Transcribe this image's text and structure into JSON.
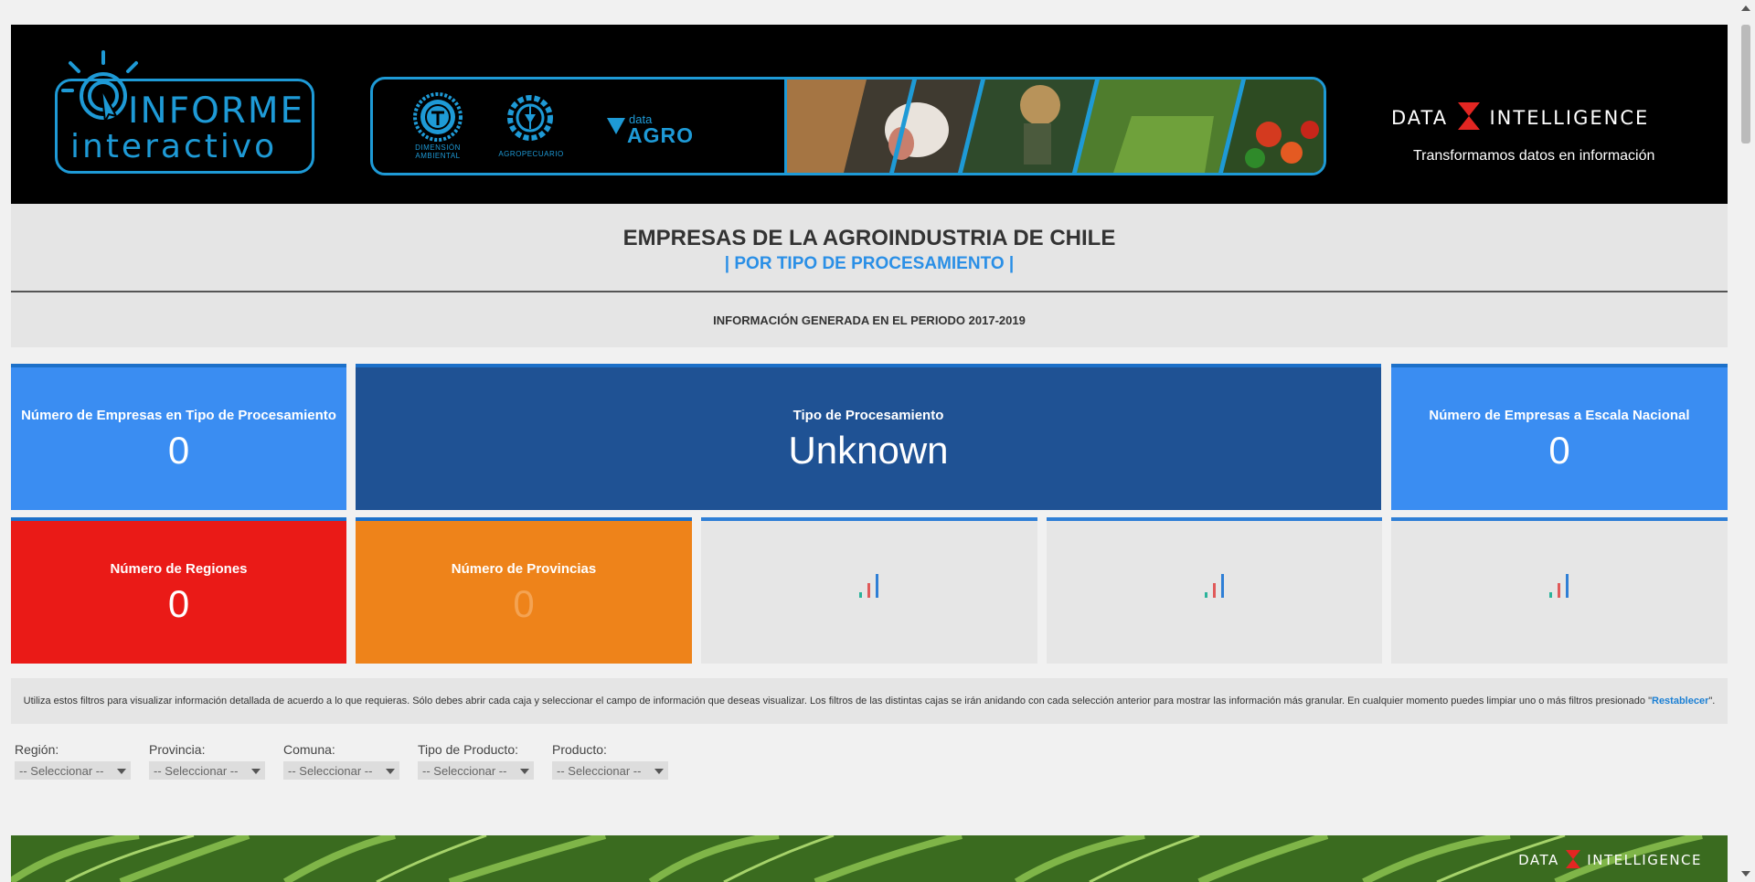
{
  "header": {
    "logo_line1": "INFORME",
    "logo_line2": "interactivo",
    "badges": {
      "dimension": "DIMENSIÓN AMBIENTAL",
      "agro": "AGROPECUARIO",
      "data_small": "data",
      "data_big": "AGRO"
    },
    "brand_left": "DATA",
    "brand_right": "INTELLIGENCE",
    "tagline": "Transformamos datos en información"
  },
  "title": {
    "main": "EMPRESAS DE LA AGROINDUSTRIA DE CHILE",
    "sub": "| POR TIPO DE PROCESAMIENTO |",
    "period": "INFORMACIÓN GENERADA EN EL PERIODO 2017-2019"
  },
  "cards": {
    "empresas_tipo": {
      "label": "Número de Empresas en Tipo de Procesamiento",
      "value": "0"
    },
    "tipo": {
      "label": "Tipo de Procesamiento",
      "value": "Unknown"
    },
    "empresas_nacional": {
      "label": "Número de Empresas a Escala Nacional",
      "value": "0"
    },
    "regiones": {
      "label": "Número de Regiones",
      "value": "0"
    },
    "provincias": {
      "label": "Número de Provincias",
      "value": "0"
    }
  },
  "info": {
    "text": "Utiliza estos filtros para visualizar información detallada de acuerdo a lo que requieras. Sólo debes abrir cada caja y seleccionar el campo de información que deseas visualizar. Los filtros de las distintas cajas se irán anidando con cada selección anterior para mostrar las información más granular. En cualquier momento puedes limpiar uno o más filtros presionado \"",
    "link": "Restablecer",
    "end": "\"."
  },
  "filters": [
    {
      "label": "Región:",
      "value": "-- Seleccionar --"
    },
    {
      "label": "Provincia:",
      "value": "-- Seleccionar --"
    },
    {
      "label": "Comuna:",
      "value": "-- Seleccionar --"
    },
    {
      "label": "Tipo de Producto:",
      "value": "-- Seleccionar --"
    },
    {
      "label": "Producto:",
      "value": "-- Seleccionar --"
    }
  ],
  "footer": {
    "brand_left": "DATA",
    "brand_right": "INTELLIGENCE"
  },
  "colors": {
    "accent": "#2a8fe6",
    "card_blue": "#3a8df2",
    "card_navy": "#1f5294",
    "card_red": "#ea1a17",
    "card_orange": "#ee831a"
  },
  "icons": [
    "bulb-icon",
    "bar-chart-loading-icon",
    "caret-down-icon"
  ]
}
